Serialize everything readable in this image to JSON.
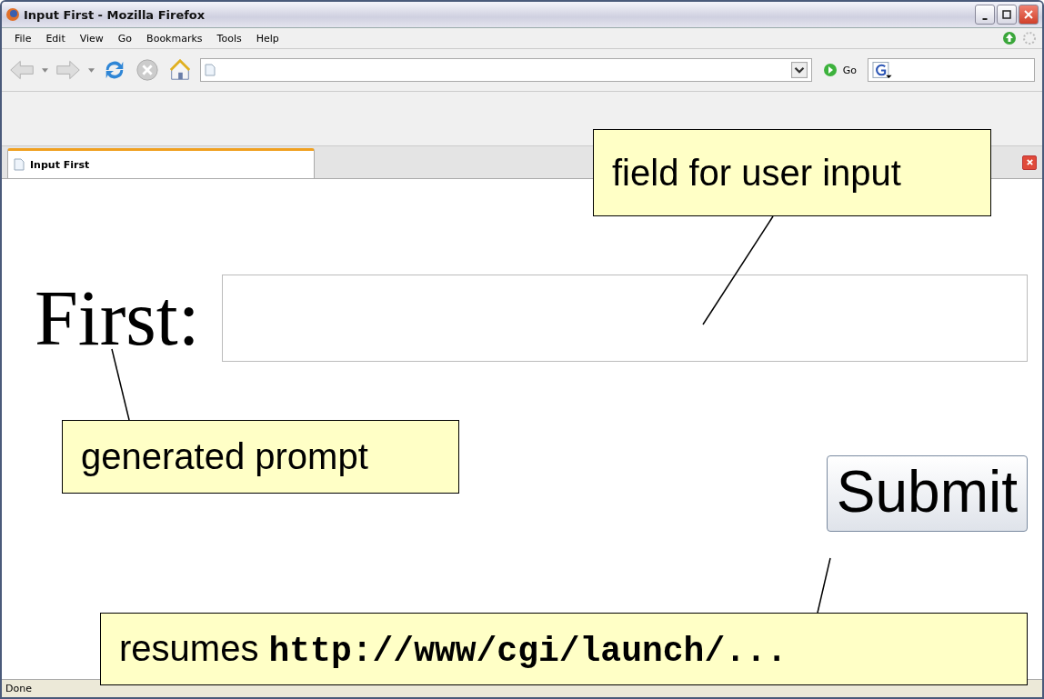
{
  "window": {
    "title": "Input First - Mozilla Firefox"
  },
  "menu": [
    "File",
    "Edit",
    "View",
    "Go",
    "Bookmarks",
    "Tools",
    "Help"
  ],
  "toolbar": {
    "go_label": "Go"
  },
  "tabs": [
    {
      "label": "Input First",
      "selected": true
    }
  ],
  "page": {
    "prompt": "First:",
    "submit": "Submit"
  },
  "callouts": [
    {
      "text": "field for user input"
    },
    {
      "text": "generated prompt"
    },
    {
      "text": "resumes **http://www/cgi/launch/...**"
    }
  ],
  "status_bar": {
    "text": "Done"
  }
}
